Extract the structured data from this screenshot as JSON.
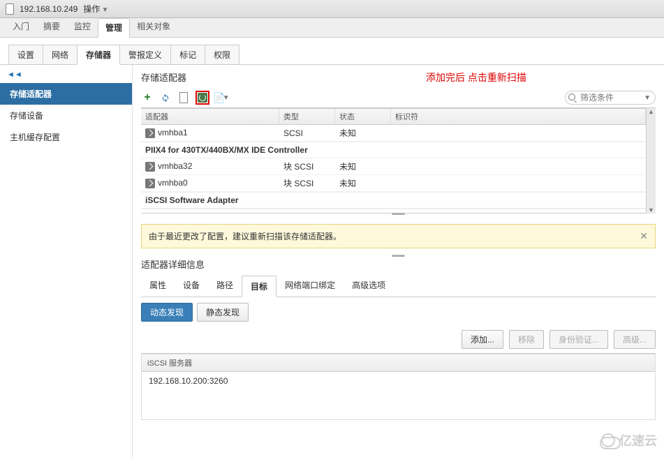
{
  "titlebar": {
    "host": "192.168.10.249",
    "actions": "操作"
  },
  "nav": [
    "入门",
    "摘要",
    "监控",
    "管理",
    "相关对象"
  ],
  "nav_active": 3,
  "subtabs": [
    "设置",
    "网络",
    "存储器",
    "警报定义",
    "标记",
    "权限"
  ],
  "subtab_active": 2,
  "sidebar": {
    "collapse": "◄◄",
    "items": [
      "存储适配器",
      "存储设备",
      "主机缓存配置"
    ],
    "active": 0
  },
  "section": {
    "title": "存储适配器"
  },
  "annotation": "添加完后 点击重新扫描",
  "filter": {
    "placeholder": "筛选条件"
  },
  "grid": {
    "headers": [
      "适配器",
      "类型",
      "状态",
      "标识符"
    ],
    "rows": [
      {
        "kind": "row",
        "name": "vmhba1",
        "type": "SCSI",
        "status": "未知",
        "id": ""
      },
      {
        "kind": "group",
        "name": "PIIX4 for 430TX/440BX/MX IDE Controller"
      },
      {
        "kind": "row",
        "name": "vmhba32",
        "type": "块 SCSI",
        "status": "未知",
        "id": ""
      },
      {
        "kind": "row",
        "name": "vmhba0",
        "type": "块 SCSI",
        "status": "未知",
        "id": ""
      },
      {
        "kind": "group",
        "name": "iSCSI Software Adapter"
      }
    ]
  },
  "alert": {
    "text": "由于最近更改了配置，建议重新扫描该存储适配器。"
  },
  "detail": {
    "title": "适配器详细信息",
    "tabs": [
      "属性",
      "设备",
      "路径",
      "目标",
      "网络端口绑定",
      "高级选项"
    ],
    "active": 3,
    "discovery": {
      "dynamic": "动态发现",
      "static": "静态发现"
    },
    "actions": {
      "add": "添加...",
      "remove": "移除",
      "auth": "身份验证...",
      "adv": "高级..."
    },
    "server_header": "iSCSI 服务器",
    "servers": [
      "192.168.10.200:3260"
    ]
  },
  "watermark": "亿速云"
}
